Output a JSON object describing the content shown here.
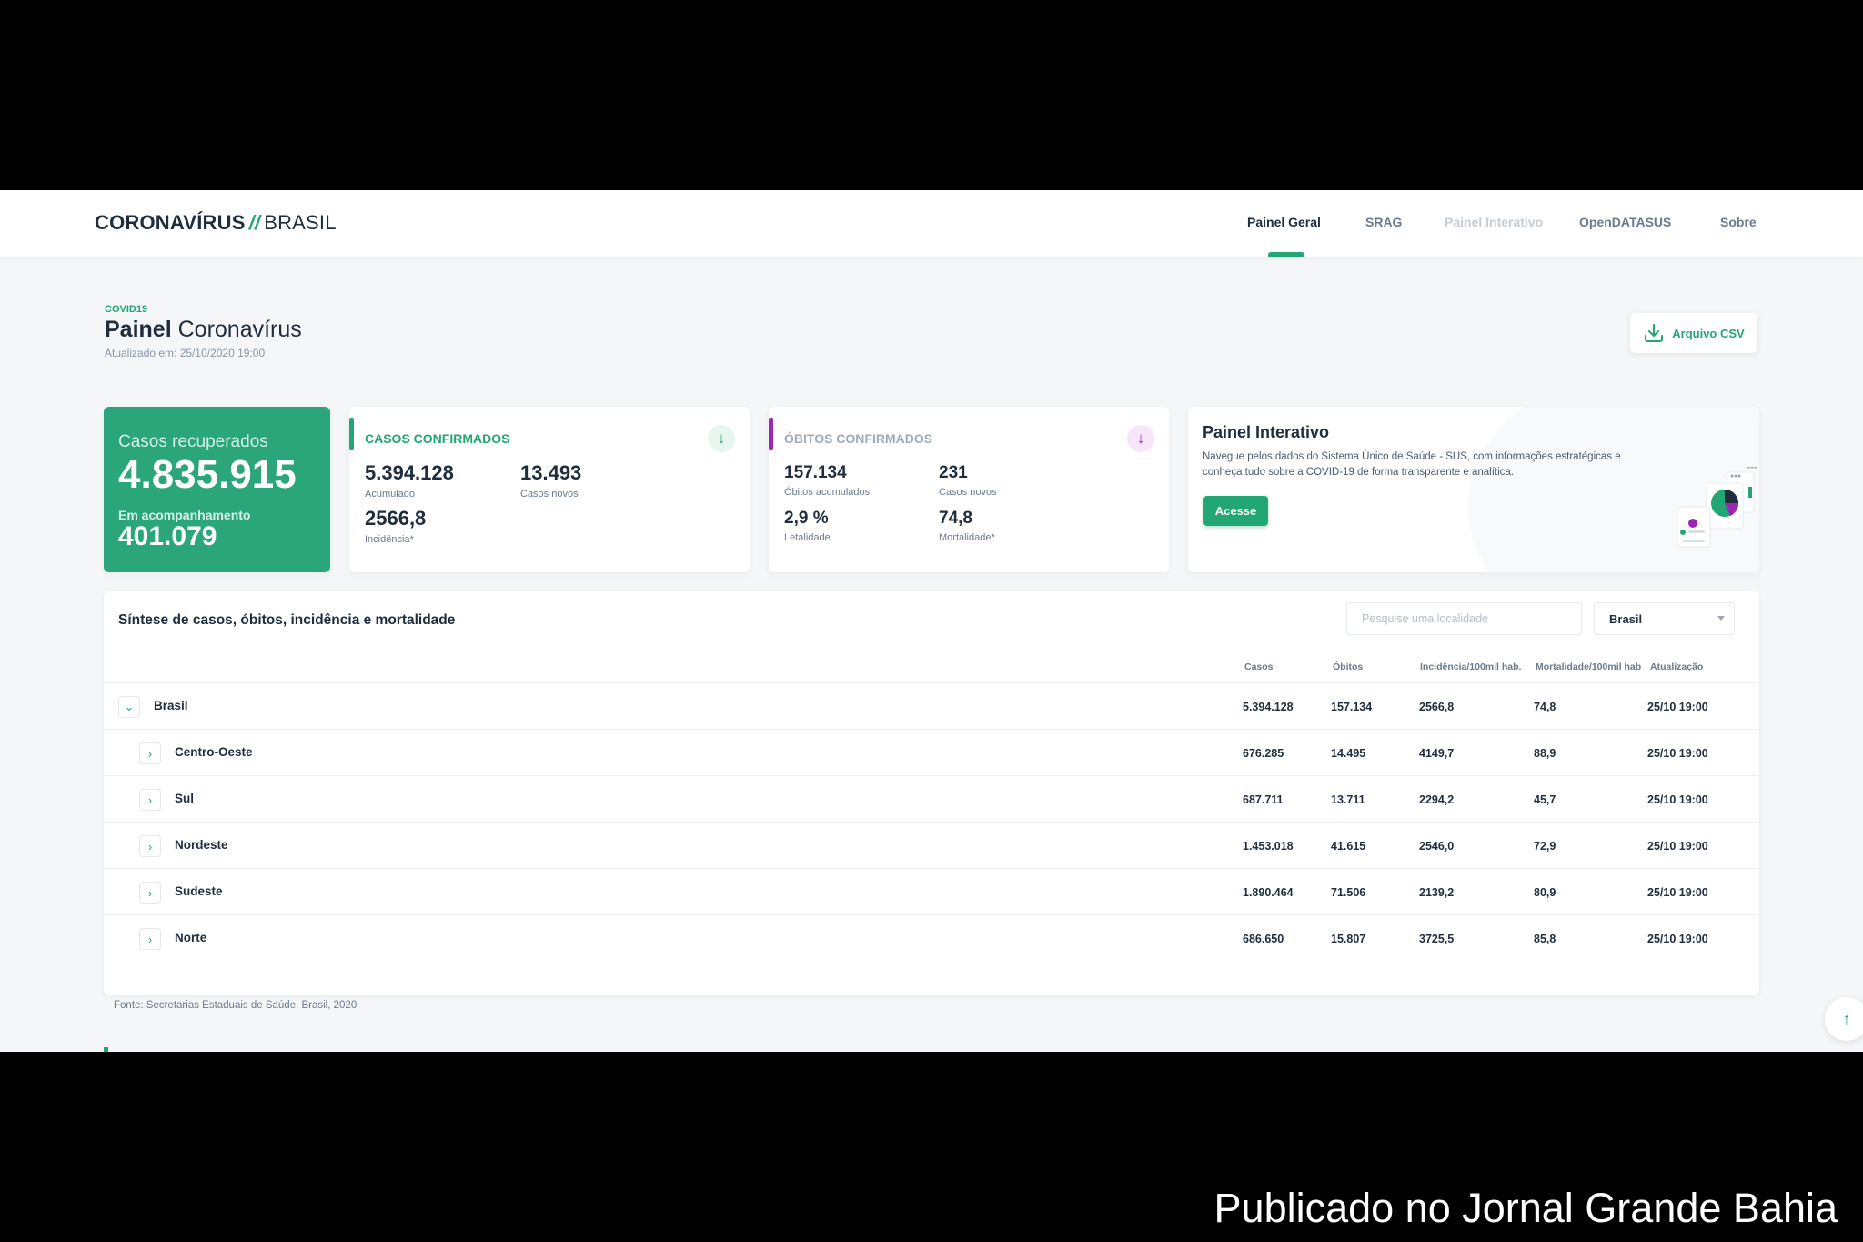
{
  "header": {
    "brand_bold": "CORONAVÍRUS",
    "brand_sep": "//",
    "brand_light": "BRASIL",
    "nav": [
      {
        "label": "Painel Geral",
        "state": "active"
      },
      {
        "label": "SRAG",
        "state": "normal"
      },
      {
        "label": "Painel Interativo",
        "state": "muted"
      },
      {
        "label": "OpenDATASUS",
        "state": "normal"
      },
      {
        "label": "Sobre",
        "state": "normal"
      }
    ]
  },
  "page": {
    "tag": "COVID19",
    "title_bold": "Painel",
    "title_light": "Coronavírus",
    "updated": "Atualizado em: 25/10/2020 19:00",
    "csv_label": "Arquivo CSV"
  },
  "recovered": {
    "label": "Casos recuperados",
    "value": "4.835.915",
    "sub_label": "Em acompanhamento",
    "sub_value": "401.079"
  },
  "cases": {
    "title": "CASOS CONFIRMADOS",
    "accum_value": "5.394.128",
    "accum_label": "Acumulado",
    "new_value": "13.493",
    "new_label": "Casos novos",
    "incid_value": "2566,8",
    "incid_label": "Incidência*"
  },
  "deaths": {
    "title": "ÓBITOS CONFIRMADOS",
    "accum_value": "157.134",
    "accum_label": "Óbitos acumulados",
    "new_value": "231",
    "new_label": "Casos novos",
    "lethality_value": "2,9 %",
    "lethality_label": "Letalidade",
    "mortality_value": "74,8",
    "mortality_label": "Mortalidade*"
  },
  "panel": {
    "title": "Painel Interativo",
    "text": "Navegue pelos dados do Sistema Único de Saúde - SUS, com informações estratégicas e conheça tudo sobre a COVID-19 de forma transparente e analítica.",
    "button": "Acesse"
  },
  "table": {
    "title": "Síntese de casos, óbitos, incidência e mortalidade",
    "search_placeholder": "Pesquise uma localidade",
    "select_value": "Brasil",
    "columns": [
      "Casos",
      "Óbitos",
      "Incidência/100mil hab.",
      "Mortalidade/100mil hab",
      "Atualização"
    ],
    "rows": [
      {
        "name": "Brasil",
        "expanded": true,
        "casos": "5.394.128",
        "obitos": "157.134",
        "incidencia": "2566,8",
        "mortalidade": "74,8",
        "atualizacao": "25/10 19:00"
      },
      {
        "name": "Centro-Oeste",
        "expanded": false,
        "casos": "676.285",
        "obitos": "14.495",
        "incidencia": "4149,7",
        "mortalidade": "88,9",
        "atualizacao": "25/10 19:00"
      },
      {
        "name": "Sul",
        "expanded": false,
        "casos": "687.711",
        "obitos": "13.711",
        "incidencia": "2294,2",
        "mortalidade": "45,7",
        "atualizacao": "25/10 19:00"
      },
      {
        "name": "Nordeste",
        "expanded": false,
        "casos": "1.453.018",
        "obitos": "41.615",
        "incidencia": "2546,0",
        "mortalidade": "72,9",
        "atualizacao": "25/10 19:00"
      },
      {
        "name": "Sudeste",
        "expanded": false,
        "casos": "1.890.464",
        "obitos": "71.506",
        "incidencia": "2139,2",
        "mortalidade": "80,9",
        "atualizacao": "25/10 19:00"
      },
      {
        "name": "Norte",
        "expanded": false,
        "casos": "686.650",
        "obitos": "15.807",
        "incidencia": "3725,5",
        "mortalidade": "85,8",
        "atualizacao": "25/10 19:00"
      }
    ],
    "source": "Fonte: Secretarias Estaduais de Saúde. Brasil, 2020"
  },
  "caption": "Publicado no Jornal Grande Bahia",
  "colors": {
    "accent": "#22a774",
    "recovered_card": "#2aa67a",
    "deaths_accent": "#9c27b0"
  },
  "icons": {
    "csv": "download-icon",
    "cases": "arrow-down-icon",
    "deaths": "arrow-down-icon",
    "scroll": "arrow-up-icon"
  }
}
